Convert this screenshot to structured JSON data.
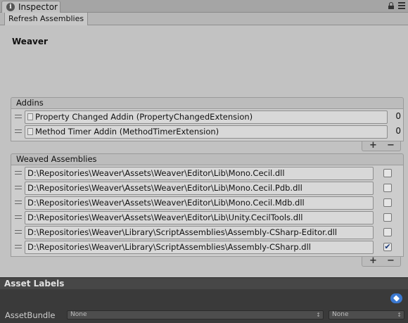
{
  "window": {
    "tab_label": "Inspector",
    "tab_icon": "info-icon",
    "lock_icon": "lock-icon",
    "menu_icon": "menu-icon"
  },
  "toolbar": {
    "refresh_label": "Refresh Assemblies"
  },
  "component": {
    "title": "Weaver"
  },
  "addins": {
    "header": "Addins",
    "items": [
      {
        "label": "Property Changed Addin (PropertyChangedExtension)",
        "value": "0"
      },
      {
        "label": "Method Timer Addin (MethodTimerExtension)",
        "value": "0"
      }
    ],
    "add_label": "+",
    "remove_label": "−"
  },
  "weaved": {
    "header": "Weaved Assemblies",
    "items": [
      {
        "path": "D:\\Repositories\\Weaver\\Assets\\Weaver\\Editor\\Lib\\Mono.Cecil.dll",
        "checked": false
      },
      {
        "path": "D:\\Repositories\\Weaver\\Assets\\Weaver\\Editor\\Lib\\Mono.Cecil.Pdb.dll",
        "checked": false
      },
      {
        "path": "D:\\Repositories\\Weaver\\Assets\\Weaver\\Editor\\Lib\\Mono.Cecil.Mdb.dll",
        "checked": false
      },
      {
        "path": "D:\\Repositories\\Weaver\\Assets\\Weaver\\Editor\\Lib\\Unity.CecilTools.dll",
        "checked": false
      },
      {
        "path": "D:\\Repositories\\Weaver\\Library\\ScriptAssemblies\\Assembly-CSharp-Editor.dll",
        "checked": false
      },
      {
        "path": "D:\\Repositories\\Weaver\\Library\\ScriptAssemblies\\Assembly-CSharp.dll",
        "checked": true
      }
    ],
    "add_label": "+",
    "remove_label": "−"
  },
  "asset_labels": {
    "title": "Asset Labels",
    "tag_icon": "tag-icon"
  },
  "asset_bundle": {
    "label": "AssetBundle",
    "bundle_value": "None",
    "variant_value": "None"
  },
  "colors": {
    "panel": "#c2c2c2",
    "dark_panel": "#3a3a3a",
    "accent": "#3b78d0"
  }
}
